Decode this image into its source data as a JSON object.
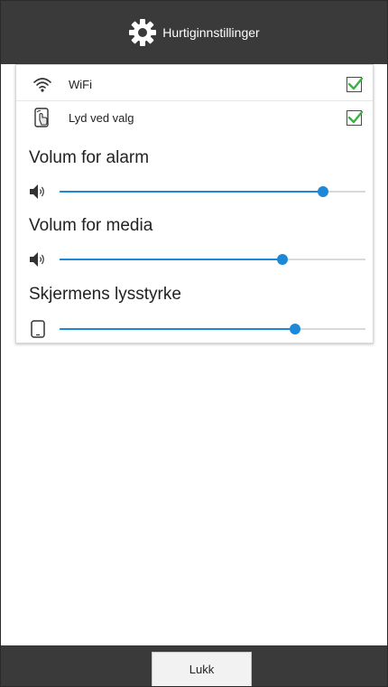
{
  "header": {
    "title": "Hurtiginnstillinger",
    "icon": "gear-icon"
  },
  "toggles": [
    {
      "label": "WiFi",
      "icon": "wifi-icon",
      "checked": true
    },
    {
      "label": "Lyd ved valg",
      "icon": "touch-sound-icon",
      "checked": true
    }
  ],
  "sliders": [
    {
      "title": "Volum for alarm",
      "icon": "speaker-icon",
      "level": 0.86
    },
    {
      "title": "Volum for media",
      "icon": "speaker-icon",
      "level": 0.73
    },
    {
      "title": "Skjermens lysstyrke",
      "icon": "phone-icon",
      "level": 0.77
    }
  ],
  "footer": {
    "close_label": "Lukk"
  },
  "colors": {
    "bar_background": "#3a3a3a",
    "accent": "#1e88d8",
    "check": "#3cb043"
  }
}
